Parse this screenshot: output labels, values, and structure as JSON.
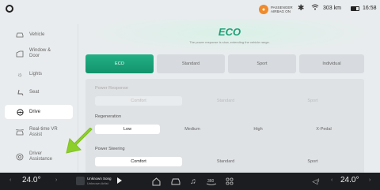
{
  "status": {
    "airbag_text": "PASSENGER AIRBAG ON",
    "range": "303 km",
    "time": "16:58"
  },
  "sidebar": {
    "items": [
      {
        "label": "Vehicle",
        "icon": "car-icon"
      },
      {
        "label": "Window & Door",
        "icon": "window-door-icon"
      },
      {
        "label": "Lights",
        "icon": "light-icon"
      },
      {
        "label": "Seat",
        "icon": "seat-icon"
      },
      {
        "label": "Drive",
        "icon": "steering-wheel-icon",
        "active": true
      },
      {
        "label": "Real-time VR Assist",
        "icon": "vr-assist-icon"
      },
      {
        "label": "Driver Assistance",
        "icon": "driver-assist-icon"
      }
    ]
  },
  "main": {
    "mode_title": "ECO",
    "mode_desc": "The power response is slow, extending the vehicle range.",
    "mode_tabs": [
      "ECO",
      "Standard",
      "Sport",
      "Individual"
    ],
    "power_response": {
      "label": "Power Response",
      "options": [
        "Comfort",
        "Standard",
        "Sport"
      ],
      "selected": "Comfort"
    },
    "regeneration": {
      "label": "Regeneration",
      "options": [
        "Low",
        "Medium",
        "High",
        "X-Pedal"
      ],
      "selected": "Low"
    },
    "power_steering": {
      "label": "Power Steering",
      "options": [
        "Comfort",
        "Standard",
        "Sport"
      ],
      "selected": "Comfort"
    }
  },
  "bottom": {
    "temp_left": "24.0°",
    "temp_right": "24.0°",
    "song_title": "Unknown Song",
    "song_artist": "Unknown Artist"
  },
  "colors": {
    "accent": "#1f9e76",
    "arrow": "#8ccf2a"
  }
}
